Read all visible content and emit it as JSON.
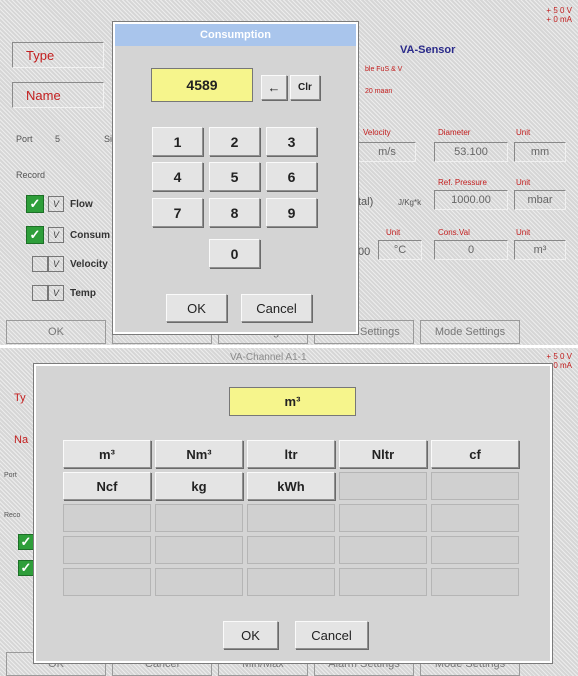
{
  "background_top": {
    "title": "VA-Sensor",
    "type_label": "Type",
    "name_label": "Name",
    "type_sub": "ble FuS & V",
    "name_sub": "20 maan",
    "port_label": "Port",
    "port_value": "5",
    "port_extra": "Si",
    "record_label": "Record",
    "records": [
      {
        "label": "Flow",
        "checked": true
      },
      {
        "label": "Consum",
        "checked": true
      },
      {
        "label": "Velocity",
        "checked": false
      },
      {
        "label": "Temp",
        "checked": false
      }
    ],
    "velocity_header": "Velocity",
    "velocity_unit": "m/s",
    "diameter_header": "Diameter",
    "diameter_value": "53.100",
    "unit_header_1": "Unit",
    "diameter_unit": "mm",
    "ratio_text": "tal)",
    "ratio_unit": "J/Kg*k",
    "ref_pressure_header": "Ref. Pressure",
    "ref_pressure_value": "1000.00",
    "unit_header_2": "Unit",
    "pressure_unit": "mbar",
    "unit_header_3": "Unit",
    "temp_value": "00",
    "temp_unit": "°C",
    "counter_header": "Cons.Val",
    "counter_value": "0",
    "unit_header_4": "Unit",
    "counter_unit": "m³",
    "voltage_1": "+ 5 0 V",
    "voltage_2": "+ 0 mA",
    "bottom_buttons": [
      "OK",
      "Cancel",
      "Message",
      "Alarm Settings",
      "Mode Settings"
    ]
  },
  "consumption_dialog": {
    "title": "Consumption",
    "value": "4589",
    "backspace_label": "←",
    "clear_label": "Clr",
    "keys": [
      "1",
      "2",
      "3",
      "4",
      "5",
      "6",
      "7",
      "8",
      "9",
      "0"
    ],
    "ok_label": "OK",
    "cancel_label": "Cancel"
  },
  "background_bottom": {
    "title": "VA-Channel A1-1",
    "type_label": "Ty",
    "name_label": "Na",
    "port_label": "Port",
    "record_label": "Reco",
    "voltage_1": "+ 5 0 V",
    "voltage_2": "+ 0 mA",
    "bottom_buttons": [
      "OK",
      "Cancel",
      "Min/Max",
      "Alarm Settings",
      "Mode Settings"
    ]
  },
  "unit_dialog": {
    "selected_unit": "m³",
    "units": [
      "m³",
      "Nm³",
      "ltr",
      "Nltr",
      "cf",
      "Ncf",
      "kg",
      "kWh"
    ],
    "empty_cells": 17,
    "ok_label": "OK",
    "cancel_label": "Cancel"
  }
}
